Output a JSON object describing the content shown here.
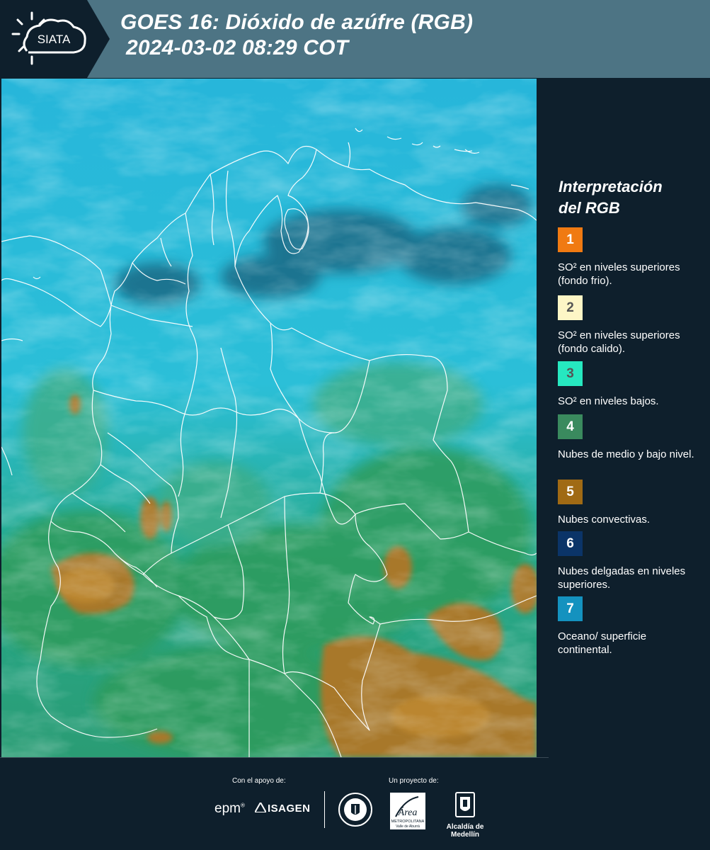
{
  "header": {
    "logo_text": "SIATA",
    "title_line1": "GOES 16: Dióxido de azúfre (RGB)",
    "title_line2": "2024-03-02 08:29 COT"
  },
  "legend": {
    "title_line1": "Interpretación",
    "title_line2": "del RGB",
    "items": [
      {
        "number": "1",
        "color": "#f07a12",
        "label": "SO² en niveles superiores (fondo frio)."
      },
      {
        "number": "2",
        "color": "#fdf6c6",
        "label": "SO² en niveles superiores (fondo calido)."
      },
      {
        "number": "3",
        "color": "#26e8c0",
        "label": "SO² en niveles bajos."
      },
      {
        "number": "4",
        "color": "#3a8a5e",
        "label": "Nubes de medio y bajo nivel."
      },
      {
        "number": "5",
        "color": "#a06a14",
        "label": "Nubes convectivas."
      },
      {
        "number": "6",
        "color": "#0b3468",
        "label": "Nubes delgadas en niveles superiores."
      },
      {
        "number": "7",
        "color": "#1492bf",
        "label": "Oceano/ superficie continental."
      }
    ]
  },
  "footer": {
    "support_label": "Con el apoyo de:",
    "project_label": "Un proyecto de:",
    "epm_text": "epm",
    "isagen_text": "ISAGEN",
    "amva_text": "Área",
    "amva_sub1": "METROPOLITANA",
    "amva_sub2": "Valle de Aburrá",
    "alcaldia_label": "Alcaldía de Medellín"
  },
  "colors": {
    "header_bg": "#4d7484",
    "logo_bg": "#0e1f2c",
    "page_bg": "#0e1f2c",
    "ocean": "#2ab6d6",
    "land_low_clouds": "#3a9a6a",
    "convective": "#a8782a"
  }
}
